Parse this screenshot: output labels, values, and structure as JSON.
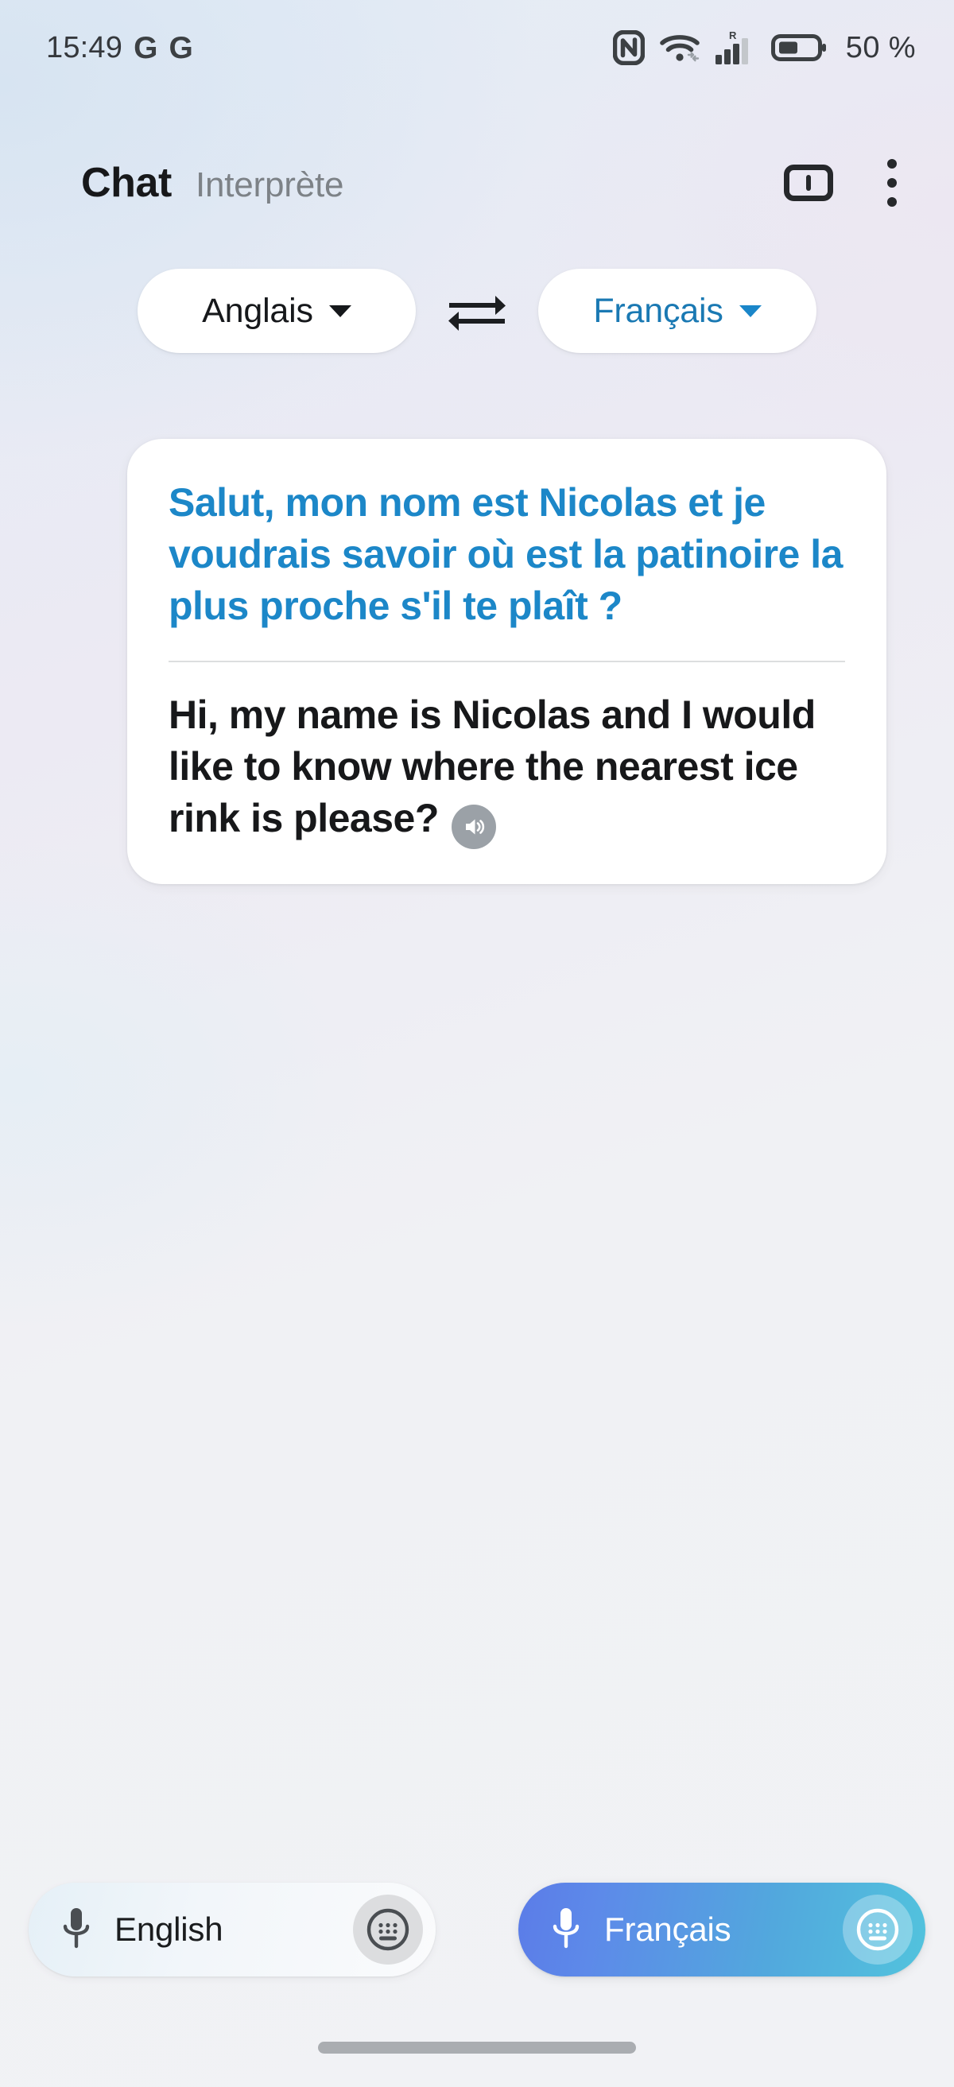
{
  "status_bar": {
    "time": "15:49",
    "app_badges": [
      "G",
      "G"
    ],
    "icons": [
      "nfc-icon",
      "wifi-icon",
      "cellular-signal-icon",
      "battery-icon"
    ],
    "roaming_indicator": "R",
    "battery_percent": "50 %"
  },
  "app_bar": {
    "tabs": [
      {
        "label": "Chat",
        "active": true
      },
      {
        "label": "Interprète",
        "active": false
      }
    ],
    "actions": [
      "split-screen-icon",
      "overflow-menu-icon"
    ]
  },
  "language_bar": {
    "source_language": "Anglais",
    "target_language": "Français",
    "swap_icon": "swap-horizontal-icon"
  },
  "conversation": {
    "card": {
      "translated_text": "Salut, mon nom est Nicolas et je voudrais savoir où est la patinoire la plus proche s'il te plaît ?",
      "source_text": "Hi, my name is Nicolas and I would like to know where the nearest ice rink is please?",
      "tts_icon": "speaker-icon"
    }
  },
  "bottom_bar": {
    "source_button": {
      "label": "English",
      "mic_icon": "microphone-icon",
      "keyboard_icon": "keyboard-icon"
    },
    "target_button": {
      "label": "Français",
      "mic_icon": "microphone-icon",
      "keyboard_icon": "keyboard-icon"
    }
  },
  "colors": {
    "accent_blue": "#1c87c8",
    "chip_blue": "#1a79b3",
    "text_dark": "#17181a",
    "text_muted": "#7d8287",
    "card_bg": "#ffffff",
    "tts_circle": "#9ba1a7",
    "gradient_start": "#5b7ce8",
    "gradient_end": "#52c3dd"
  }
}
